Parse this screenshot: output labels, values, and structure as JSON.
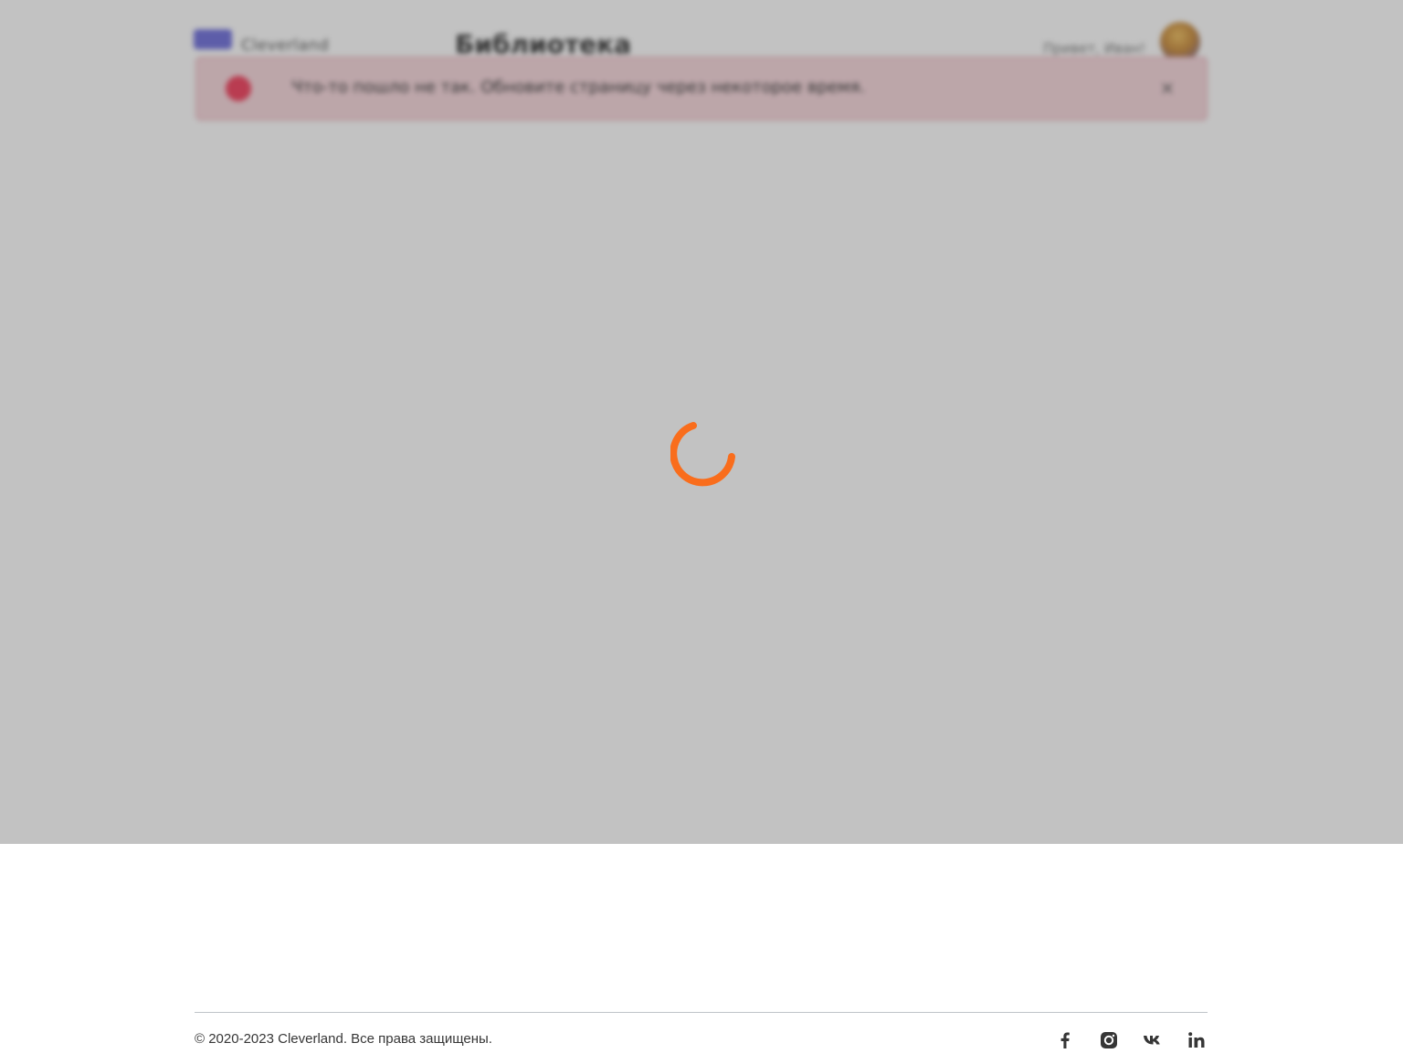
{
  "header": {
    "logo_text": "Cleverland",
    "page_title": "Библиотека",
    "greeting": "Привет, Иван!"
  },
  "error_toast": {
    "message": "Что-то пошло не так. Обновите страницу через некоторое время.",
    "close_glyph": "×"
  },
  "loader": {
    "color": "#f96d1c"
  },
  "footer": {
    "copyright": "© 2020-2023 Cleverland. Все права защищены.",
    "socials": [
      {
        "name": "facebook-icon"
      },
      {
        "name": "instagram-icon"
      },
      {
        "name": "vk-icon"
      },
      {
        "name": "linkedin-icon"
      }
    ]
  }
}
